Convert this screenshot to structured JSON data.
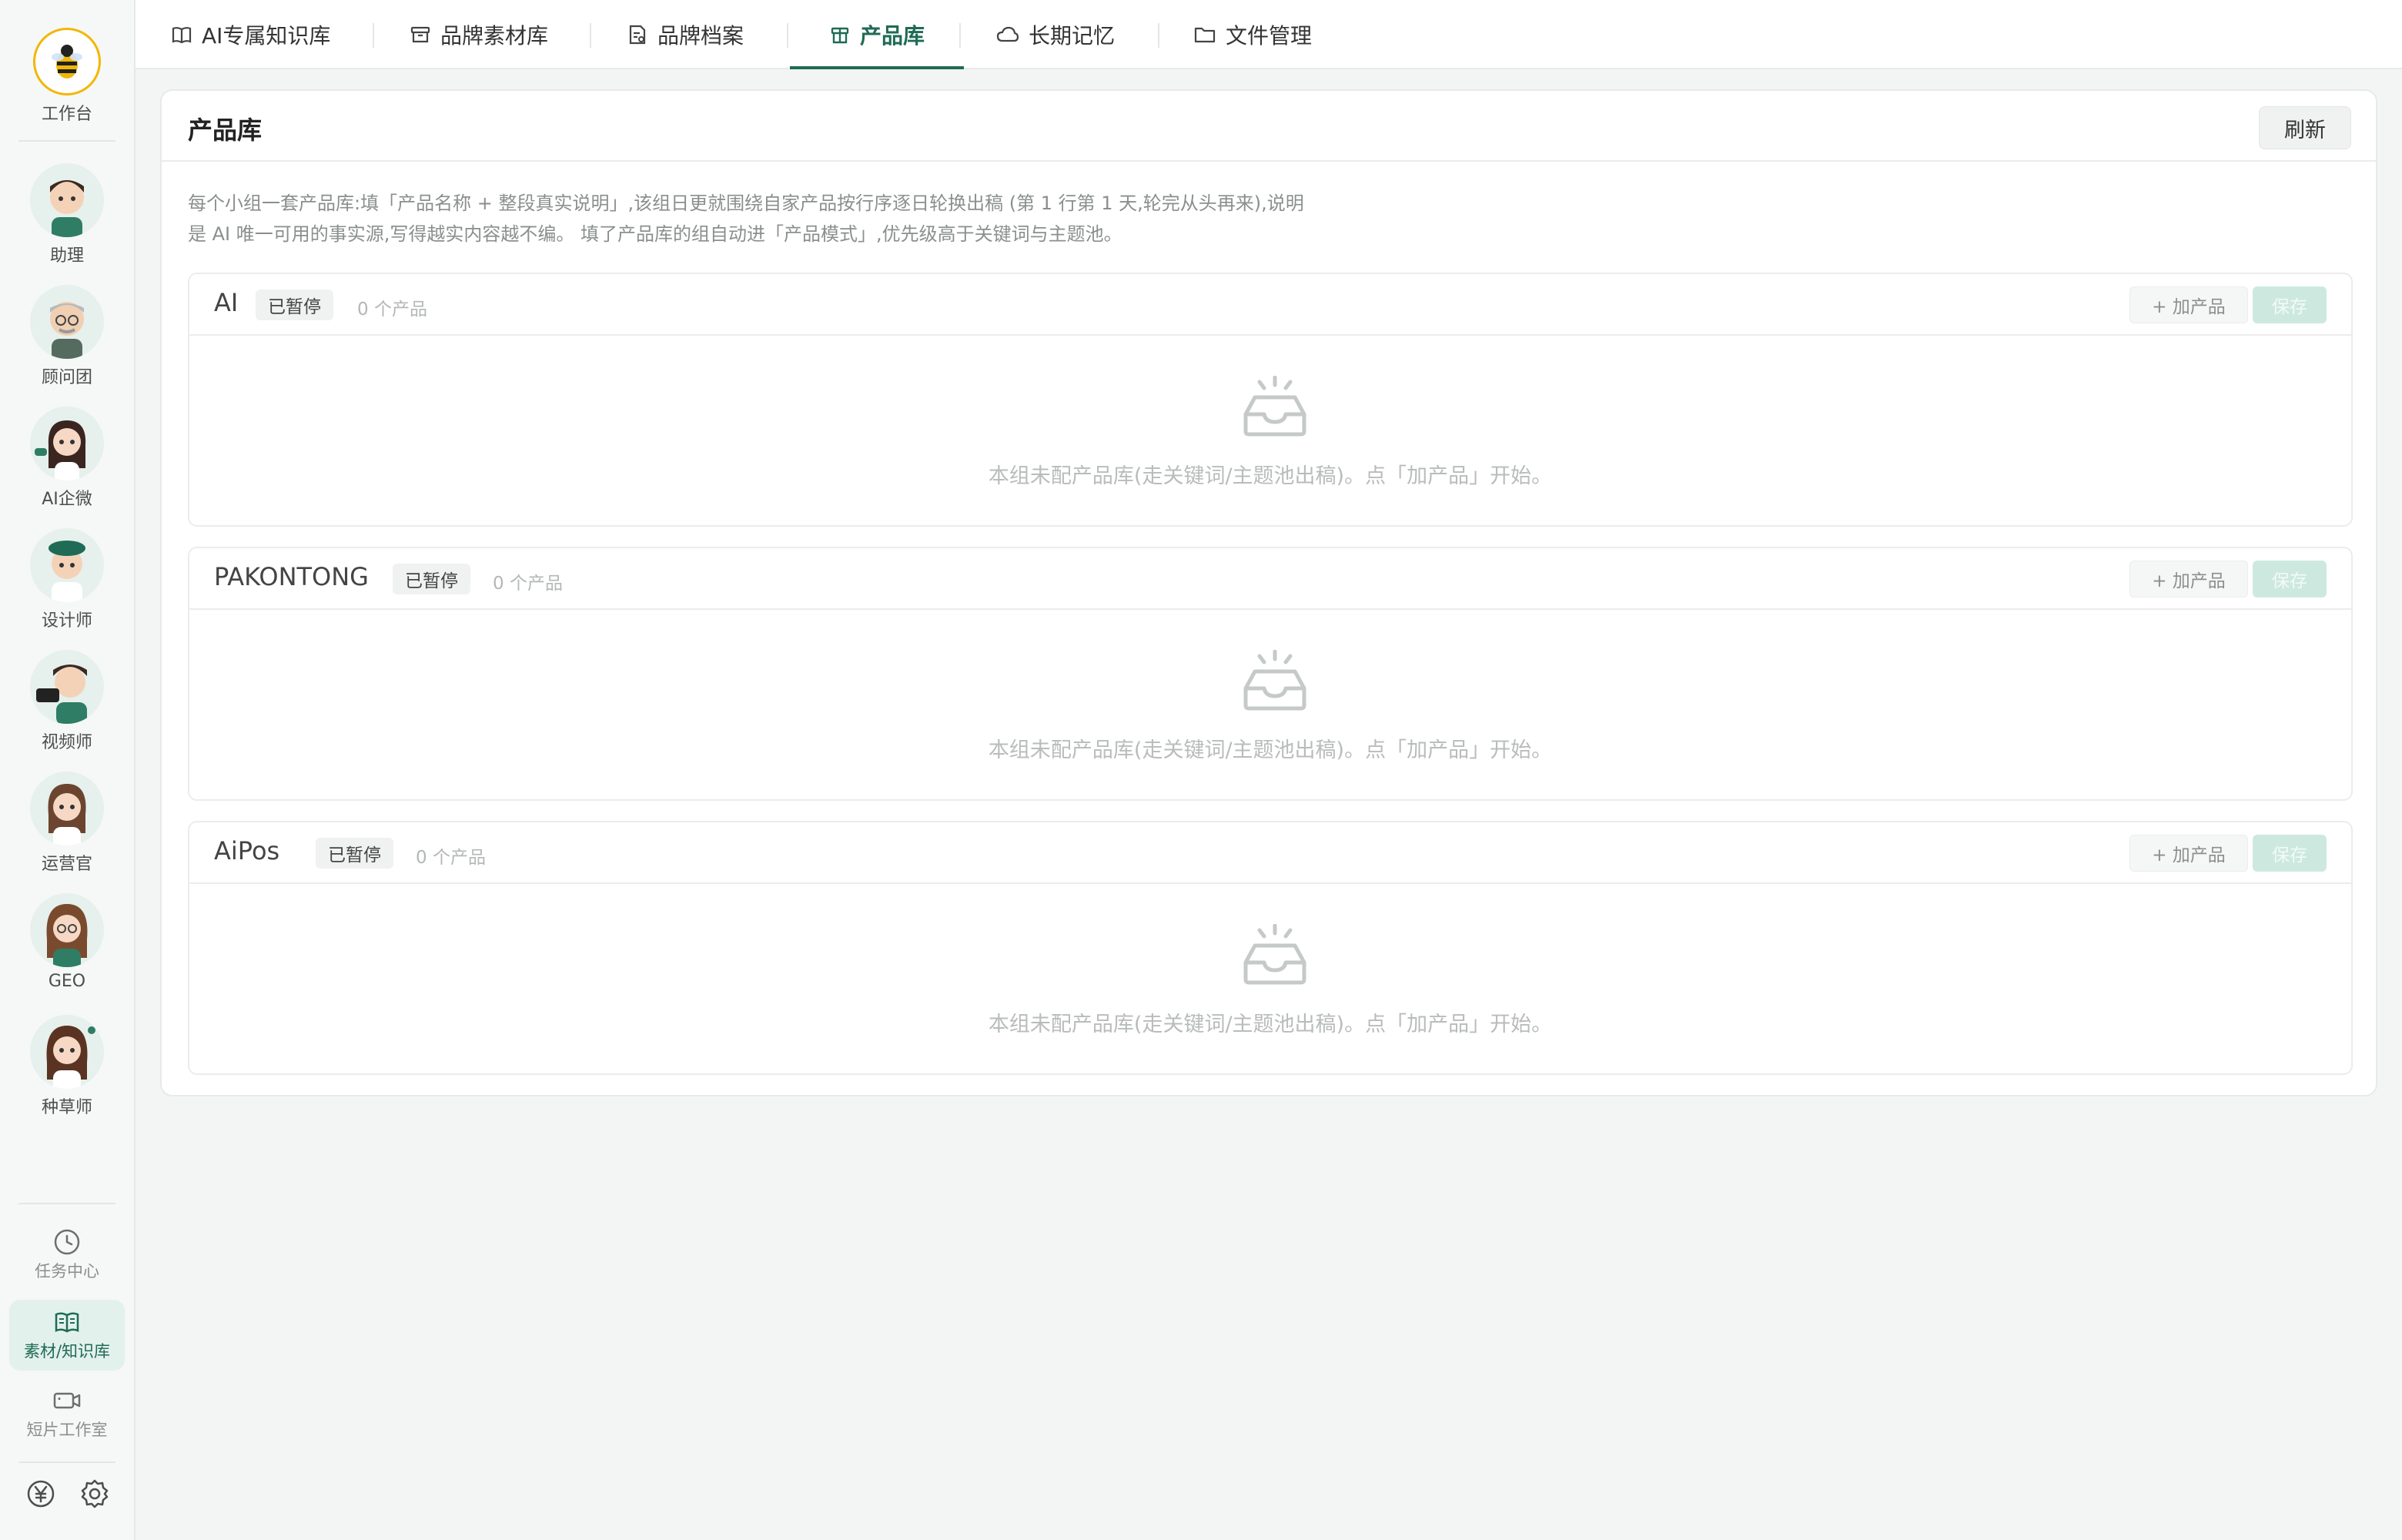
{
  "sidebar": {
    "logo_label": "工作台",
    "agents": [
      {
        "label": "助理",
        "icon": "assistant-avatar"
      },
      {
        "label": "顾问团",
        "icon": "advisor-avatar"
      },
      {
        "label": "AI企微",
        "icon": "wecom-avatar"
      },
      {
        "label": "设计师",
        "icon": "designer-avatar"
      },
      {
        "label": "视频师",
        "icon": "videographer-avatar"
      },
      {
        "label": "运营官",
        "icon": "operator-avatar"
      },
      {
        "label": "GEO",
        "icon": "geo-avatar"
      },
      {
        "label": "种草师",
        "icon": "seeding-avatar"
      }
    ],
    "nav": [
      {
        "label": "任务中心",
        "icon": "clock-icon"
      },
      {
        "label": "素材/知识库",
        "icon": "book-icon",
        "active": true
      },
      {
        "label": "短片工作室",
        "icon": "video-camera-icon"
      }
    ],
    "bottom_icons": [
      "yuan-icon",
      "gear-icon"
    ]
  },
  "tabs": [
    {
      "label": "AI专属知识库",
      "icon": "book-icon"
    },
    {
      "label": "品牌素材库",
      "icon": "archive-icon"
    },
    {
      "label": "品牌档案",
      "icon": "file-icon"
    },
    {
      "label": "产品库",
      "icon": "box-icon",
      "active": true
    },
    {
      "label": "长期记忆",
      "icon": "cloud-icon"
    },
    {
      "label": "文件管理",
      "icon": "folder-icon"
    }
  ],
  "card": {
    "title": "产品库",
    "refresh_label": "刷新",
    "description_line1": "每个小组一套产品库:填「产品名称 + 整段真实说明」,该组日更就围绕自家产品按行序逐日轮换出稿 (第 1 行第 1 天,轮完从头再来),说明",
    "description_line2": "是 AI 唯一可用的事实源,写得越实内容越不编。 填了产品库的组自动进「产品模式」,优先级高于关键词与主题池。"
  },
  "groups": [
    {
      "name": "AI",
      "status": "已暂停",
      "count": "0 个产品",
      "add_label": "+ 加产品",
      "save_label": "保存",
      "empty_text": "本组未配产品库(走关键词/主题池出稿)。点「加产品」开始。"
    },
    {
      "name": "PAKONTONG",
      "status": "已暂停",
      "count": "0 个产品",
      "add_label": "+ 加产品",
      "save_label": "保存",
      "empty_text": "本组未配产品库(走关键词/主题池出稿)。点「加产品」开始。"
    },
    {
      "name": "AiPos",
      "status": "已暂停",
      "count": "0 个产品",
      "add_label": "+ 加产品",
      "save_label": "保存",
      "empty_text": "本组未配产品库(走关键词/主题池出稿)。点「加产品」开始。"
    }
  ],
  "colors": {
    "accent": "#1f6b55",
    "save_disabled": "#cde9df",
    "logo_ring": "#f2b705"
  }
}
